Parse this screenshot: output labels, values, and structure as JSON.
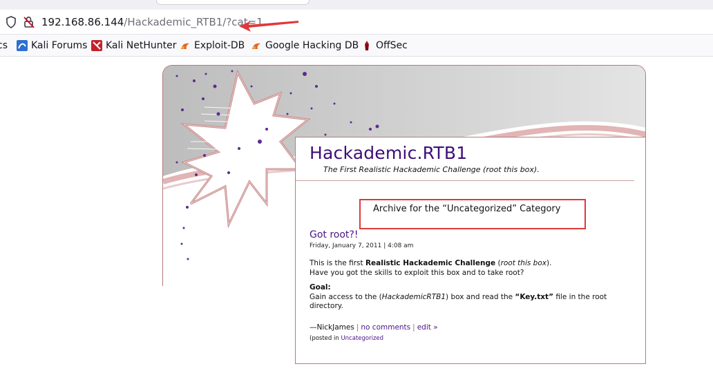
{
  "browser": {
    "url_host": "192.168.86.144",
    "url_path": "/Hackademic_RTB1/?cat=1",
    "bookmarks": [
      {
        "label": "cs",
        "icon": "kali-docs-icon"
      },
      {
        "label": "Kali Forums",
        "icon": "kali-forums-icon"
      },
      {
        "label": "Kali NetHunter",
        "icon": "nethunter-icon"
      },
      {
        "label": "Exploit-DB",
        "icon": "exploit-db-icon"
      },
      {
        "label": "Google Hacking DB",
        "icon": "ghdb-icon"
      },
      {
        "label": "OffSec",
        "icon": "offsec-icon"
      }
    ],
    "annotation_color": "#e0383b"
  },
  "blog": {
    "title": "Hackademic.RTB1",
    "description": "The First Realistic Hackademic Challenge (root this box).",
    "title_color": "#3d0e78"
  },
  "archive": {
    "heading_prefix": "Archive for the",
    "category": "“Uncategorized”",
    "heading_suffix": "Category"
  },
  "post": {
    "title": "Got root?!",
    "date": "Friday, January 7, 2011 | 4:08 am",
    "p1_a": "This is the first ",
    "p1_b": "Realistic Hackademic Challenge",
    "p1_c": " (",
    "p1_d": "root this box",
    "p1_e": ").",
    "p2": "Have you got the skills to exploit this box and to take root?",
    "goal_label": "Goal:",
    "goal_a": "Gain access to the (",
    "goal_b": "HackademicRTB1",
    "goal_c": ") box and read the ",
    "goal_d": "“Key.txt”",
    "goal_e": " file in the root directory.",
    "author": "—NickJames",
    "comments_link": "no comments",
    "edit_link": "edit »",
    "filed_prefix": "(posted in ",
    "filed_category": "Uncategorized",
    "filed_suffix": ""
  }
}
